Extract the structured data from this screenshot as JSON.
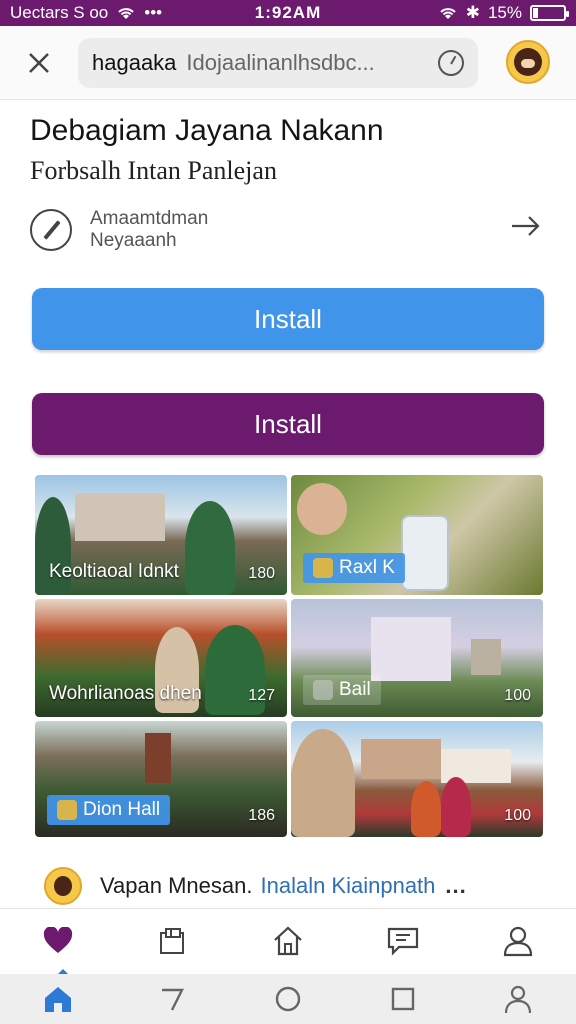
{
  "status_bar": {
    "carrier": "Uectars S oo",
    "time": "1:92AM",
    "battery": "15%",
    "battery_level": 0.15
  },
  "browser": {
    "url_domain": "hagaaka",
    "url_path": "Idojaalinanlhsdbc..."
  },
  "header": {
    "title": "Debagiam Jayana Nakann",
    "subtitle": "Forbsalh Intan Panlejan",
    "edit_line1": "Amaamtdman",
    "edit_line2": "Neyaaanh"
  },
  "buttons": {
    "install_primary": "Install",
    "install_secondary": "Install"
  },
  "gallery": [
    {
      "caption": "Keoltiaoal Idnkt",
      "count": "180"
    },
    {
      "caption": "Raxl K",
      "count": ""
    },
    {
      "caption": "Wohrlianoas dhen",
      "count": "127"
    },
    {
      "caption": "Bail",
      "count": "100"
    },
    {
      "caption": "Dion Hall",
      "count": "186"
    },
    {
      "caption": "",
      "count": "100"
    }
  ],
  "comment": {
    "user": "Vapan Mnesan.",
    "link": "Inalaln Kiainpnath",
    "more": "..."
  },
  "tabs": [
    {
      "icon": "heart-icon",
      "active": true
    },
    {
      "icon": "bookmarks-icon",
      "active": false
    },
    {
      "icon": "home-icon",
      "active": false
    },
    {
      "icon": "chat-icon",
      "active": false
    },
    {
      "icon": "profile-icon",
      "active": false
    }
  ],
  "colors": {
    "brand_purple": "#6c1a6e",
    "accent_blue": "#4095ea",
    "link_blue": "#2f6fb6"
  }
}
